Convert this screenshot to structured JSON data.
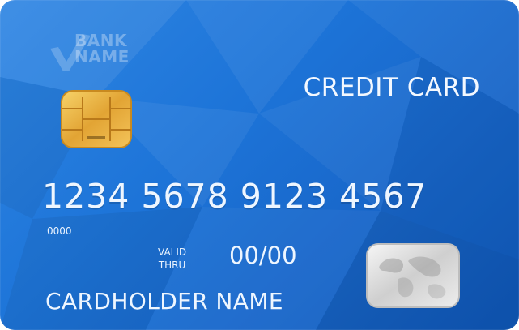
{
  "card": {
    "bank_line1": "BANK",
    "bank_line2": "NAME",
    "title": "CREDIT CARD",
    "number": "1234 5678 9123 4567",
    "small_number": "0000",
    "valid_line1": "VALID",
    "valid_line2": "THRU",
    "expiry": "00/00",
    "cardholder": "CARDHOLDER NAME"
  },
  "colors": {
    "card_blue": "#1d74d8",
    "text": "#eef6ff",
    "chip_gold": "#e3a83a",
    "hologram_silver": "#d9d9d9"
  },
  "icons": {
    "bank_logo": "check-mark-logo",
    "chip": "emv-chip",
    "hologram": "world-map-hologram"
  }
}
